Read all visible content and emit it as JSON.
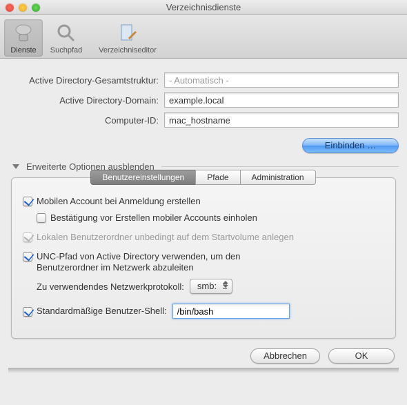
{
  "window": {
    "title": "Verzeichnisdienste"
  },
  "toolbar": {
    "services": "Dienste",
    "searchpath": "Suchpfad",
    "editor": "Verzeichniseditor"
  },
  "form": {
    "forest_label": "Active Directory-Gesamtstruktur:",
    "forest_value": "- Automatisch -",
    "domain_label": "Active Directory-Domain:",
    "domain_value": "example.local",
    "computer_label": "Computer-ID:",
    "computer_value": "mac_hostname",
    "bind_button": "Einbinden …"
  },
  "expander": {
    "label": "Erweiterte Optionen ausblenden"
  },
  "tabs": {
    "users": "Benutzereinstellungen",
    "paths": "Pfade",
    "admin": "Administration"
  },
  "options": {
    "mobile": "Mobilen Account bei Anmeldung erstellen",
    "confirm": "Bestätigung vor Erstellen mobiler Accounts einholen",
    "localhome": "Lokalen Benutzerordner unbedingt auf dem Startvolume anlegen",
    "unc": "UNC-Pfad von Active Directory verwenden, um den Benutzerordner im Netzwerk abzuleiten",
    "protocol_label": "Zu verwendendes Netzwerkprotokoll:",
    "protocol_value": "smb:",
    "shell_label": "Standardmäßige Benutzer-Shell:",
    "shell_value": "/bin/bash"
  },
  "footer": {
    "cancel": "Abbrechen",
    "ok": "OK"
  }
}
